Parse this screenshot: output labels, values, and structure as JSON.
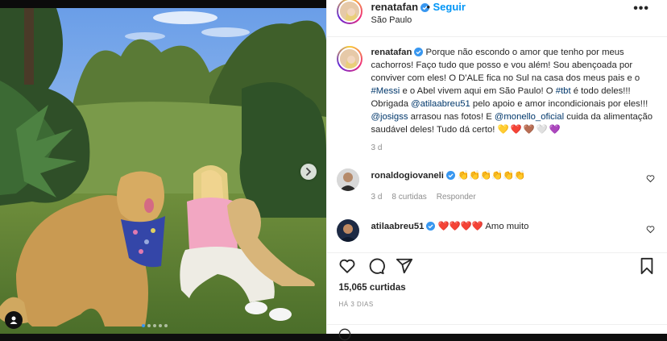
{
  "header": {
    "username": "renatafan",
    "follow_label": "Seguir",
    "location": "São Paulo",
    "more_icon": "•••"
  },
  "caption": {
    "username": "renatafan",
    "part1": "Porque não escondo o amor que tenho por meus cachorros! Faço tudo que posso e vou além! Sou abençoada por conviver com eles! O D'ALE fica no Sul na casa dos meus pais e o ",
    "tag_messi": "#Messi",
    "part2": " e o Abel vivem aqui em São Paulo! O ",
    "tag_tbt": "#tbt",
    "part3": " é todo deles!!! Obrigada ",
    "mention_atila": "@atilaabreu51",
    "part4": " pelo apoio e amor incondicionais por eles!!! ",
    "mention_josi": "@josigss",
    "part5": " arrasou nas fotos! E ",
    "mention_monello": "@monello_oficial",
    "part6": " cuida da alimentação saudável deles! Tudo dá certo! ",
    "emojis": "💛❤️🤎🤍💜",
    "time": "3 d"
  },
  "comments": [
    {
      "username": "ronaldogiovaneli",
      "text": "👏👏👏👏👏👏",
      "time": "3 d",
      "likes": "8 curtidas",
      "reply": "Responder"
    },
    {
      "username": "atilaabreu51",
      "text": "❤️❤️❤️❤️ Amo muito"
    }
  ],
  "post": {
    "likes": "15,065 curtidas",
    "date": "HÁ 3 DIAS"
  },
  "colors": {
    "accent": "#0095f6",
    "verified": "#3897f0",
    "link": "#00376b"
  },
  "carousel": {
    "current": 1,
    "total": 5
  }
}
